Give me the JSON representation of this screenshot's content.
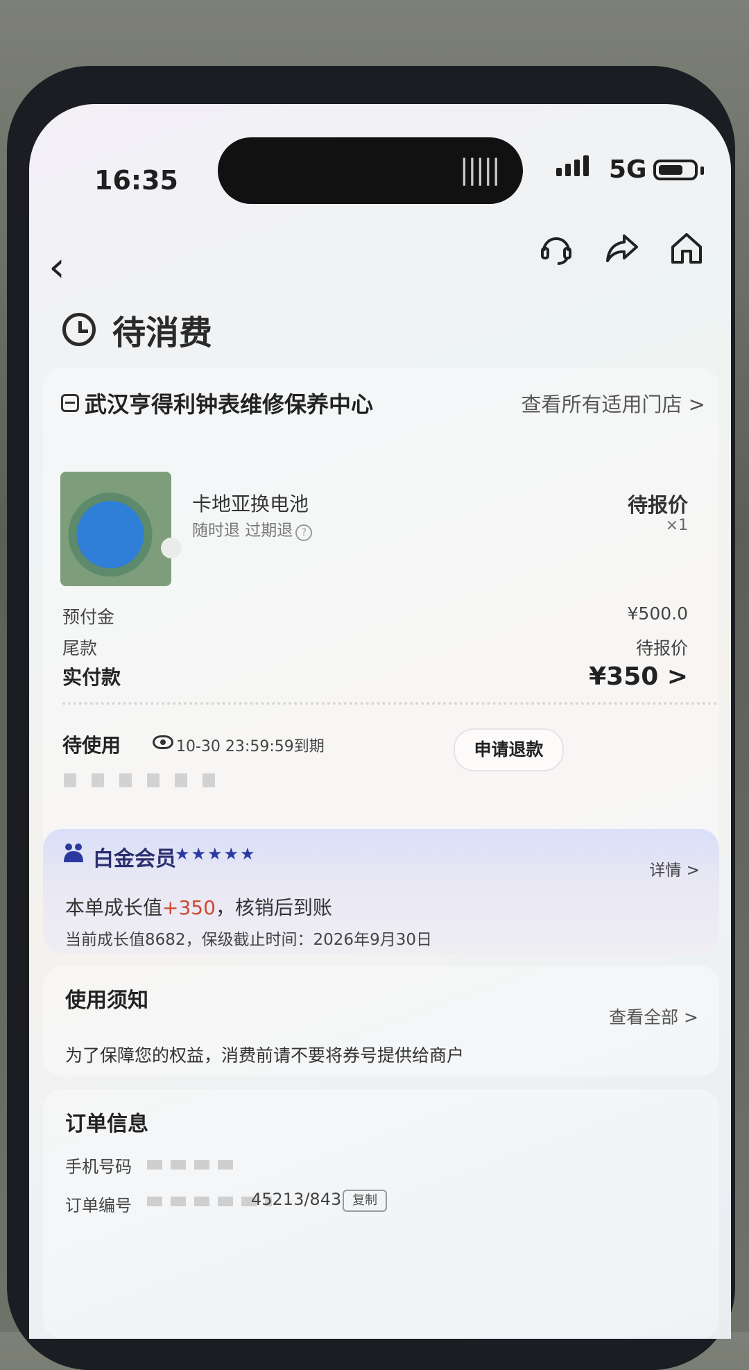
{
  "status_bar": {
    "time": "16:35",
    "network": "5G"
  },
  "header": {
    "title": "待消费"
  },
  "store": {
    "name": "武汉亨得利钟表维修保养中心",
    "link": "查看所有适用门店 >"
  },
  "product": {
    "name": "卡地亚换电池",
    "tags": "随时退 过期退",
    "price_status": "待报价",
    "quantity": "×1"
  },
  "payment": {
    "deposit_label": "预付金",
    "deposit_value": "¥500.0",
    "balance_label": "尾款",
    "balance_value": "待报价",
    "paid_label": "实付款",
    "paid_value": "¥350 >"
  },
  "voucher": {
    "status": "待使用",
    "expire": "10-30 23:59:59到期",
    "refund_button": "申请退款"
  },
  "member": {
    "title": "白金会员",
    "stars": "★★★★★",
    "detail_link": "详情 >",
    "growth_prefix": "本单成长值",
    "growth_value": "+350",
    "growth_suffix": "，核销后到账",
    "growth_sub": "当前成长值8682，保级截止时间：2026年9月30日"
  },
  "notice": {
    "title": "使用须知",
    "view_all": "查看全部 >",
    "text": "为了保障您的权益，消费前请不要将券号提供给商户"
  },
  "order": {
    "title": "订单信息",
    "phone_label": "手机号码",
    "no_label": "订单编号",
    "no_tail": "45213/843",
    "copy_button": "复制"
  },
  "icons": [
    "back-icon",
    "customer-service-icon",
    "share-icon",
    "home-icon",
    "clock-icon",
    "store-icon",
    "eye-icon",
    "member-icon"
  ]
}
